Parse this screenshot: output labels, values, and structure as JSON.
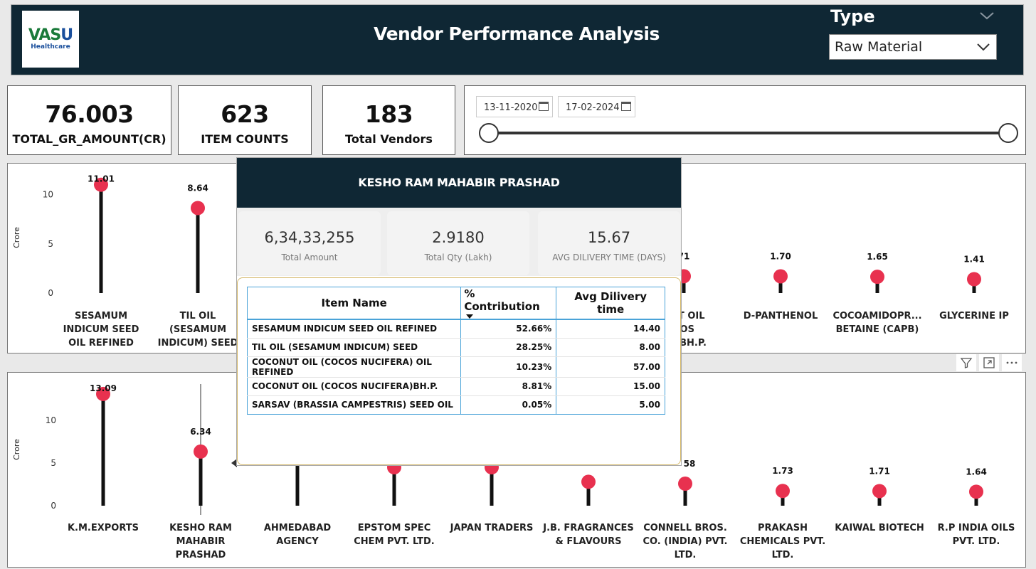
{
  "header": {
    "logo_main_1": "VAS",
    "logo_main_2": "U",
    "logo_sub": "Healthcare",
    "title": "Vendor Performance Analysis",
    "type_label": "Type",
    "type_value": "Raw Material"
  },
  "kpis": [
    {
      "value": "76.003",
      "label": "TOTAL_GR_AMOUNT(CR)"
    },
    {
      "value": "623",
      "label": "ITEM COUNTS"
    },
    {
      "value": "183",
      "label": "Total Vendors"
    }
  ],
  "date_slicer": {
    "start": "13-11-2020",
    "end": "17-02-2024",
    "start_level": 0,
    "end_level": 1
  },
  "chart_data": [
    {
      "type": "lollipop",
      "ylabel": "Crore",
      "ylim": [
        0,
        12
      ],
      "yticks": [
        "0",
        "5",
        "10"
      ],
      "categories": [
        "SESAMUM INDICUM SEED OIL REFINED",
        "TIL OIL (SESAMUM INDICUM) SEED",
        "NUT OIL COS RA)BH.P.",
        "D-PANTHENOL",
        "COCOAMIDOPR... BETAINE (CAPB)",
        "GLYCERINE IP"
      ],
      "values": [
        11.01,
        8.64,
        1.71,
        1.7,
        1.65,
        1.41
      ],
      "value_labels": [
        "11.01",
        "8.64",
        "71",
        "1.70",
        "1.65",
        "1.41"
      ],
      "category_lines": [
        [
          "SESAMUM",
          "INDICUM SEED",
          "OIL REFINED"
        ],
        [
          "TIL OIL",
          "(SESAMUM",
          "INDICUM) SEED"
        ],
        [
          "NUT OIL",
          "COS",
          "RA)BH.P."
        ],
        [
          "D-PANTHENOL"
        ],
        [
          "COCOAMIDOPR...",
          "BETAINE (CAPB)"
        ],
        [
          "GLYCERINE IP"
        ]
      ]
    },
    {
      "type": "lollipop",
      "ylabel": "Crore",
      "ylim": [
        0,
        14
      ],
      "yticks": [
        "0",
        "5",
        "10"
      ],
      "categories": [
        "K.M.EXPORTS",
        "KESHO RAM MAHABIR PRASHAD",
        "AHMEDABAD AGENCY",
        "EPSTOM SPEC CHEM PVT. LTD.",
        "JAPAN TRADERS",
        "J.B. FRAGRANCES & FLAVOURS",
        "CONNELL BROS. CO. (INDIA) PVT. LTD.",
        "PRAKASH CHEMICALS PVT. LTD.",
        "KAIWAL BIOTECH",
        "R.P INDIA OILS PVT. LTD."
      ],
      "values": [
        13.09,
        6.34,
        6.0,
        4.5,
        4.5,
        2.8,
        2.58,
        1.73,
        1.71,
        1.64
      ],
      "value_labels": [
        "13.09",
        "6.34",
        "",
        "",
        "",
        "",
        "58",
        "1.73",
        "1.71",
        "1.64"
      ],
      "category_lines": [
        [
          "K.M.EXPORTS"
        ],
        [
          "KESHO RAM",
          "MAHABIR",
          "PRASHAD"
        ],
        [
          "AHMEDABAD",
          "AGENCY"
        ],
        [
          "EPSTOM SPEC",
          "CHEM PVT. LTD."
        ],
        [
          "JAPAN TRADERS"
        ],
        [
          "J.B. FRAGRANCES",
          "& FLAVOURS"
        ],
        [
          "CONNELL BROS.",
          "CO. (INDIA) PVT.",
          "LTD."
        ],
        [
          "PRAKASH",
          "CHEMICALS PVT.",
          "LTD."
        ],
        [
          "KAIWAL BIOTECH"
        ],
        [
          "R.P INDIA OILS",
          "PVT. LTD."
        ]
      ]
    }
  ],
  "colors": {
    "dot": "#e8314f",
    "header_bg": "#0f2734",
    "table_border": "#4aa3d8"
  },
  "tooltip": {
    "vendor": "KESHO RAM MAHABIR PRASHAD",
    "cards": [
      {
        "value": "6,34,33,255",
        "label": "Total Amount"
      },
      {
        "value": "2.9180",
        "label": "Total Qty (Lakh)"
      },
      {
        "value": "15.67",
        "label": "AVG DILIVERY TIME (DAYS)"
      }
    ],
    "table": {
      "headers": [
        "Item Name",
        "% Contribution",
        "Avg Dilivery time"
      ],
      "rows": [
        [
          "SESAMUM INDICUM SEED OIL REFINED",
          "52.66%",
          "14.40"
        ],
        [
          "TIL OIL (SESAMUM INDICUM) SEED",
          "28.25%",
          "8.00"
        ],
        [
          "COCONUT OIL (COCOS NUCIFERA) OIL REFINED",
          "10.23%",
          "57.00"
        ],
        [
          "COCONUT OIL (COCOS NUCIFERA)BH.P.",
          "8.81%",
          "15.00"
        ],
        [
          "SARSAV (BRASSIA CAMPESTRIS) SEED OIL",
          "0.05%",
          "5.00"
        ]
      ]
    }
  },
  "panel_icons": [
    "filter-icon",
    "focus-mode-icon",
    "more-options-icon"
  ]
}
